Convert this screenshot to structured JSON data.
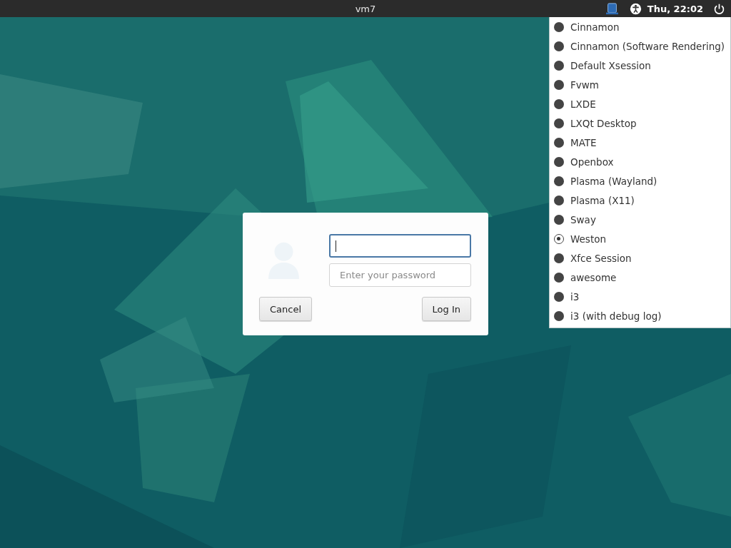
{
  "top_bar": {
    "hostname": "vm7",
    "clock": "Thu, 22:02"
  },
  "login_dialog": {
    "username_field": {
      "focused": true
    },
    "password_field": {
      "placeholder": "Enter your password"
    },
    "cancel_button": {
      "label": "Cancel"
    },
    "login_button": {
      "label": "Log In"
    }
  },
  "session_menu": {
    "items": [
      {
        "label": "Cinnamon",
        "selected": false
      },
      {
        "label": "Cinnamon (Software Rendering)",
        "selected": false
      },
      {
        "label": "Default Xsession",
        "selected": false
      },
      {
        "label": "Fvwm",
        "selected": false
      },
      {
        "label": "LXDE",
        "selected": false
      },
      {
        "label": "LXQt Desktop",
        "selected": false
      },
      {
        "label": "MATE",
        "selected": false
      },
      {
        "label": "Openbox",
        "selected": false
      },
      {
        "label": "Plasma (Wayland)",
        "selected": false
      },
      {
        "label": "Plasma (X11)",
        "selected": false
      },
      {
        "label": "Sway",
        "selected": false
      },
      {
        "label": "Weston",
        "selected": true
      },
      {
        "label": "Xfce Session",
        "selected": false
      },
      {
        "label": "awesome",
        "selected": false
      },
      {
        "label": "i3",
        "selected": false
      },
      {
        "label": "i3 (with debug log)",
        "selected": false
      }
    ]
  }
}
